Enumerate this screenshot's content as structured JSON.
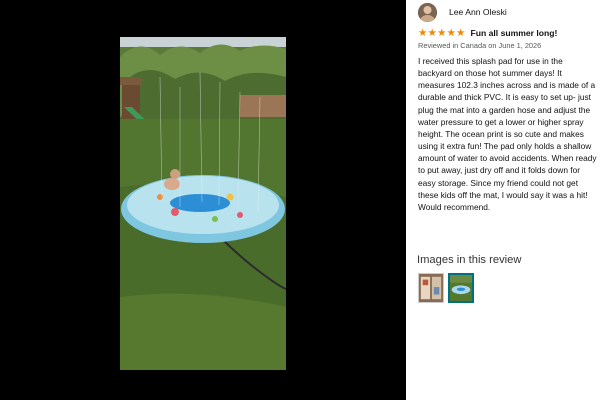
{
  "reviewer": {
    "name": "Lee Ann Oleski"
  },
  "review": {
    "rating": 5,
    "rating_max": 5,
    "title": "Fun all summer long!",
    "meta": "Reviewed in Canada on June 1, 2026",
    "body": "I received this splash pad for use in the backyard on those hot summer days! It measures 102.3 inches across and is made of a durable and thick PVC. It is easy to set up- just plug the mat into a garden hose and adjust the water pressure to get a lower or higher spray height. The ocean print is so cute and makes using it extra fun! The pad only holds a shallow amount of water to avoid accidents. When ready to put away, just dry off and it folds down for easy storage. Since my friend could not get these kids off the mat, I would say it was a hit! Would recommend."
  },
  "images_section": {
    "heading": "Images in this review",
    "thumbnail_count": 2,
    "selected_index": 1
  },
  "colors": {
    "star": "#f08804",
    "selected_border": "#007185"
  }
}
